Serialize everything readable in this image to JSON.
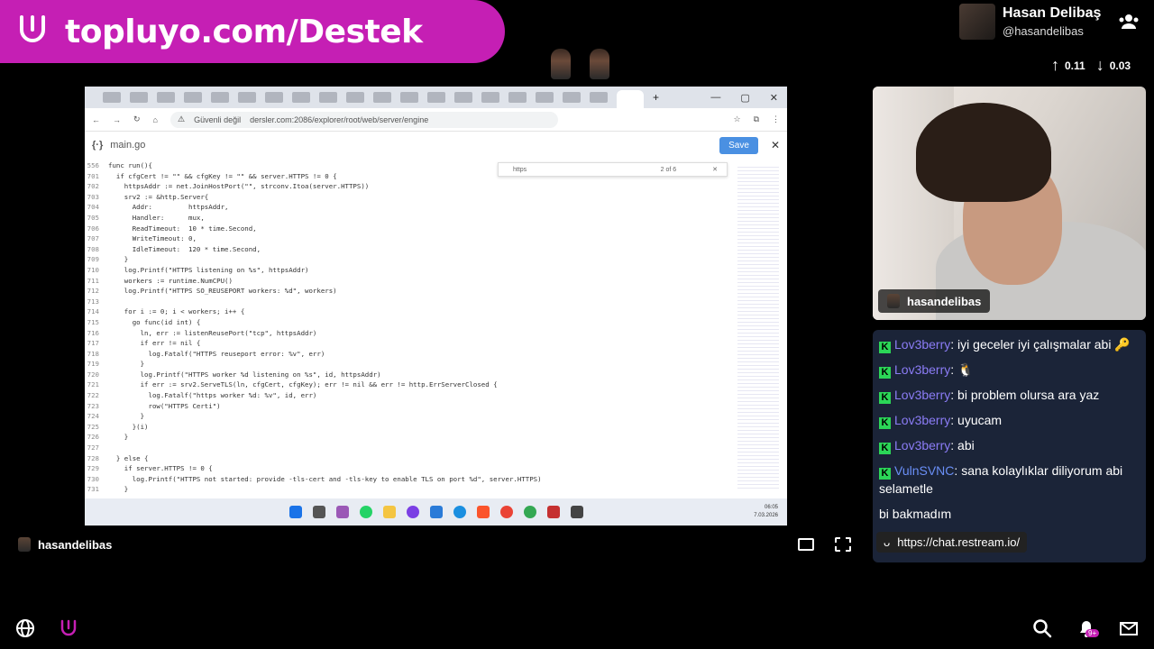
{
  "banner": {
    "text": "topluyo.com/Destek"
  },
  "profile": {
    "name": "Hasan Delibaş",
    "handle": "@hasandelibas"
  },
  "stats": {
    "up": "0.11",
    "down": "0.03"
  },
  "browser": {
    "security": "Güvenli değil",
    "url": "dersler.com:2086/explorer/root/web/server/engine",
    "file": "main.go",
    "save_label": "Save",
    "find_query": "https",
    "find_count": "2 of 6",
    "clock_time": "06:05",
    "clock_date": "7.03.2026"
  },
  "code_lines": [
    {
      "n": "556",
      "t": "func run(){"
    },
    {
      "n": "701",
      "t": "  if cfgCert != \"\" && cfgKey != \"\" && server.HTTPS != 0 {"
    },
    {
      "n": "702",
      "t": "    httpsAddr := net.JoinHostPort(\"\", strconv.Itoa(server.HTTPS))"
    },
    {
      "n": "703",
      "t": "    srv2 := &http.Server{"
    },
    {
      "n": "704",
      "t": "      Addr:         httpsAddr,"
    },
    {
      "n": "705",
      "t": "      Handler:      mux,"
    },
    {
      "n": "706",
      "t": "      ReadTimeout:  10 * time.Second,"
    },
    {
      "n": "707",
      "t": "      WriteTimeout: 0,"
    },
    {
      "n": "708",
      "t": "      IdleTimeout:  120 * time.Second,"
    },
    {
      "n": "709",
      "t": "    }"
    },
    {
      "n": "710",
      "t": "    log.Printf(\"HTTPS listening on %s\", httpsAddr)"
    },
    {
      "n": "711",
      "t": "    workers := runtime.NumCPU()"
    },
    {
      "n": "712",
      "t": "    log.Printf(\"HTTPS SO_REUSEPORT workers: %d\", workers)"
    },
    {
      "n": "713",
      "t": ""
    },
    {
      "n": "714",
      "t": "    for i := 0; i < workers; i++ {"
    },
    {
      "n": "715",
      "t": "      go func(id int) {"
    },
    {
      "n": "716",
      "t": "        ln, err := listenReusePort(\"tcp\", httpsAddr)"
    },
    {
      "n": "717",
      "t": "        if err != nil {"
    },
    {
      "n": "718",
      "t": "          log.Fatalf(\"HTTPS reuseport error: %v\", err)"
    },
    {
      "n": "719",
      "t": "        }"
    },
    {
      "n": "720",
      "t": "        log.Printf(\"HTTPS worker %d listening on %s\", id, httpsAddr)"
    },
    {
      "n": "721",
      "t": "        if err := srv2.ServeTLS(ln, cfgCert, cfgKey); err != nil && err != http.ErrServerClosed {"
    },
    {
      "n": "722",
      "t": "          log.Fatalf(\"https worker %d: %v\", id, err)"
    },
    {
      "n": "723",
      "t": "          row(\"HTTPS Certi\")"
    },
    {
      "n": "724",
      "t": "        }"
    },
    {
      "n": "725",
      "t": "      }(i)"
    },
    {
      "n": "726",
      "t": "    }"
    },
    {
      "n": "727",
      "t": ""
    },
    {
      "n": "728",
      "t": "  } else {"
    },
    {
      "n": "729",
      "t": "    if server.HTTPS != 0 {"
    },
    {
      "n": "730",
      "t": "      log.Printf(\"HTTPS not started: provide -tls-cert and -tls-key to enable TLS on port %d\", server.HTTPS)"
    },
    {
      "n": "731",
      "t": "    }"
    }
  ],
  "screen_owner": "hasandelibas",
  "cam_owner": "hasandelibas",
  "chat": [
    {
      "user": "Lov3berry",
      "text": "iyi geceler iyi çalışmalar abi 🔑",
      "color": "purple"
    },
    {
      "user": "Lov3berry",
      "text": "🐧",
      "color": "purple"
    },
    {
      "user": "Lov3berry",
      "text": "bi problem olursa ara yaz",
      "color": "purple"
    },
    {
      "user": "Lov3berry",
      "text": "uyucam",
      "color": "purple"
    },
    {
      "user": "Lov3berry",
      "text": "abi",
      "color": "purple"
    },
    {
      "user": "VulnSVNC",
      "text": "sana kolaylıklar diliyorum abi selametle",
      "color": "blue"
    },
    {
      "user": "",
      "text": "bi bakmadım",
      "color": "purple"
    }
  ],
  "chat_url": "https://chat.restream.io/",
  "notif_badge": "9+",
  "colors": {
    "banner": "#c51fb4",
    "chat_bg": "#1b2438",
    "kick": "#2bd657"
  }
}
